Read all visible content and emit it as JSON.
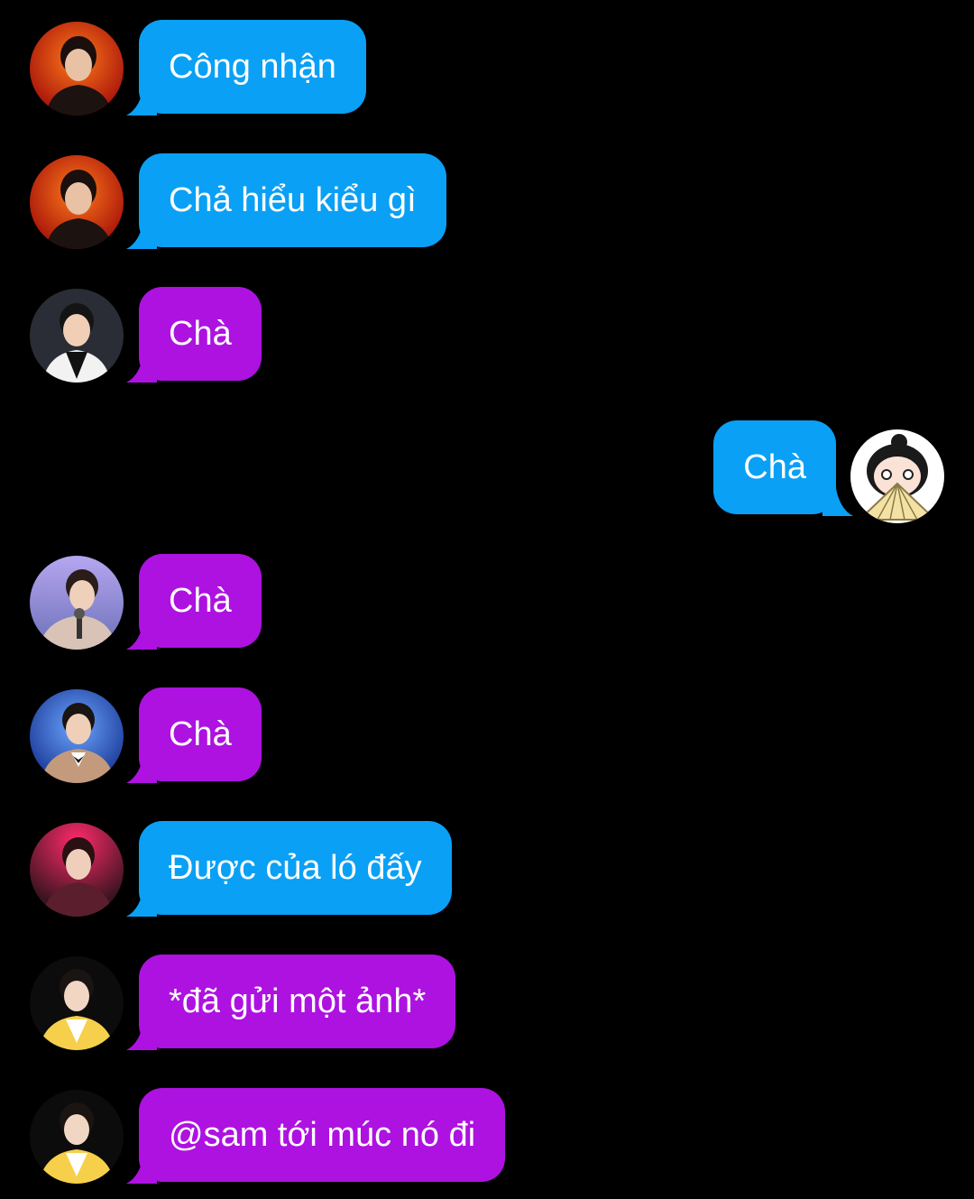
{
  "messages": [
    {
      "text": "Công nhận",
      "direction": "incoming",
      "bubble_color": "#0aa0f5",
      "avatar": "red-stage-avatar"
    },
    {
      "text": "Chả hiểu kiểu gì",
      "direction": "incoming",
      "bubble_color": "#0aa0f5",
      "avatar": "red-stage-avatar"
    },
    {
      "text": "Chà",
      "direction": "incoming",
      "bubble_color": "#ad12e0",
      "avatar": "dark-suit-avatar"
    },
    {
      "text": "Chà",
      "direction": "outgoing",
      "bubble_color": "#0aa0f5",
      "avatar": "cartoon-fan-avatar"
    },
    {
      "text": "Chà",
      "direction": "incoming",
      "bubble_color": "#ad12e0",
      "avatar": "microphone-avatar"
    },
    {
      "text": "Chà",
      "direction": "incoming",
      "bubble_color": "#ad12e0",
      "avatar": "blue-stage-avatar"
    },
    {
      "text": "Được của ló đấy",
      "direction": "incoming",
      "bubble_color": "#0aa0f5",
      "avatar": "pink-stage-avatar"
    },
    {
      "text": "*đã gửi một ảnh*",
      "direction": "incoming",
      "bubble_color": "#ad12e0",
      "avatar": "yellow-jacket-avatar"
    },
    {
      "text": "@sam tới múc nó đi",
      "direction": "incoming",
      "bubble_color": "#ad12e0",
      "avatar": "yellow-jacket-avatar"
    }
  ],
  "colors": {
    "background": "#000000",
    "blue_bubble": "#0aa0f5",
    "purple_bubble": "#ad12e0",
    "text": "#ffffff"
  }
}
